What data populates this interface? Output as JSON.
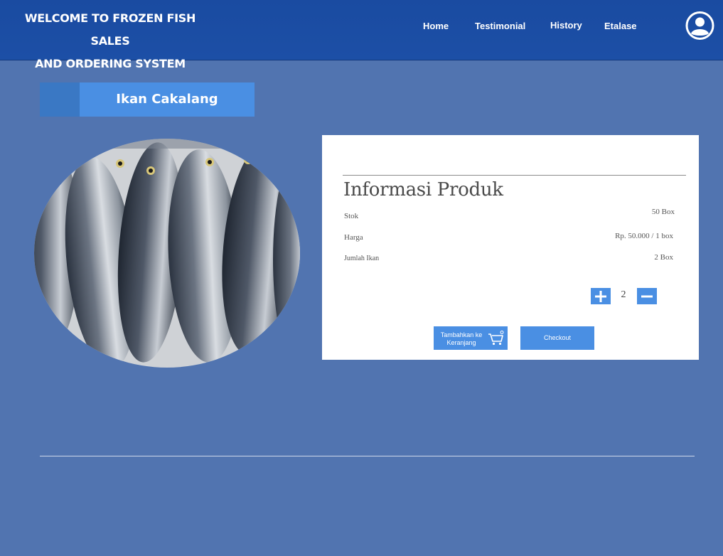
{
  "header": {
    "title_line1": "WELCOME TO FROZEN FISH SALES",
    "title_line2": "AND ORDERING SYSTEM",
    "nav": [
      "Home",
      "Testimonial",
      "History",
      "Etalase"
    ],
    "profile_icon": "user-circle-icon"
  },
  "product": {
    "name": "Ikan Cakalang",
    "image_icon": "fish-photo"
  },
  "info": {
    "heading": "Informasi Produk",
    "rows": [
      {
        "label": "Stok",
        "value": "50 Box"
      },
      {
        "label": "Harga",
        "value": "Rp. 50.000 / 1 box"
      },
      {
        "label": "Jumlah Ikan",
        "value": "2 Box"
      }
    ],
    "quantity": "2",
    "add_to_cart_line1": "Tambahkan ke",
    "add_to_cart_line2": "Keranjang",
    "checkout_label": "Checkout"
  },
  "colors": {
    "background": "#5174b0",
    "header": "#1c4fa6",
    "accent": "#4a8fe3"
  }
}
